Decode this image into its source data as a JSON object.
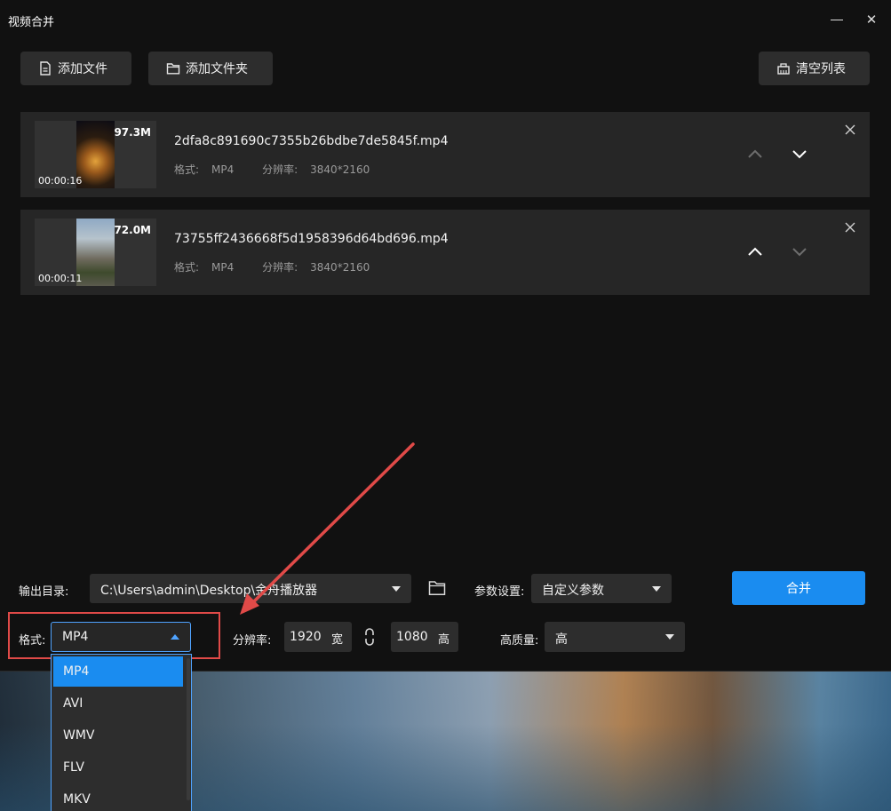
{
  "window": {
    "title": "视频合并"
  },
  "toolbar": {
    "add_file_label": "添加文件",
    "add_folder_label": "添加文件夹",
    "clear_list_label": "清空列表"
  },
  "files": [
    {
      "name": "2dfa8c891690c7355b26bdbe7de5845f.mp4",
      "size": "97.3M",
      "duration": "00:00:16",
      "format_label": "格式:",
      "format": "MP4",
      "resolution_label": "分辨率:",
      "resolution": "3840*2160"
    },
    {
      "name": "73755ff2436668f5d1958396d64bd696.mp4",
      "size": "72.0M",
      "duration": "00:00:11",
      "format_label": "格式:",
      "format": "MP4",
      "resolution_label": "分辨率:",
      "resolution": "3840*2160"
    }
  ],
  "settings": {
    "output_dir_label": "输出目录:",
    "output_dir_value": "C:\\Users\\admin\\Desktop\\金舟播放器",
    "params_label": "参数设置:",
    "params_value": "自定义参数",
    "merge_label": "合并",
    "format_label": "格式:",
    "format_value": "MP4",
    "resolution_label": "分辨率:",
    "width_value": "1920",
    "width_unit": "宽",
    "height_value": "1080",
    "height_unit": "高",
    "quality_label": "高质量:",
    "quality_value": "高"
  },
  "format_options": [
    "MP4",
    "AVI",
    "WMV",
    "FLV",
    "MKV"
  ],
  "colors": {
    "accent": "#1a8cf0",
    "highlight": "#e04a48",
    "window_bg": "#111111",
    "row_bg": "#262626"
  },
  "icons": [
    "file-icon",
    "folder-icon",
    "broom-icon",
    "chevron-up-icon",
    "chevron-down-icon",
    "close-icon",
    "link-icon"
  ]
}
